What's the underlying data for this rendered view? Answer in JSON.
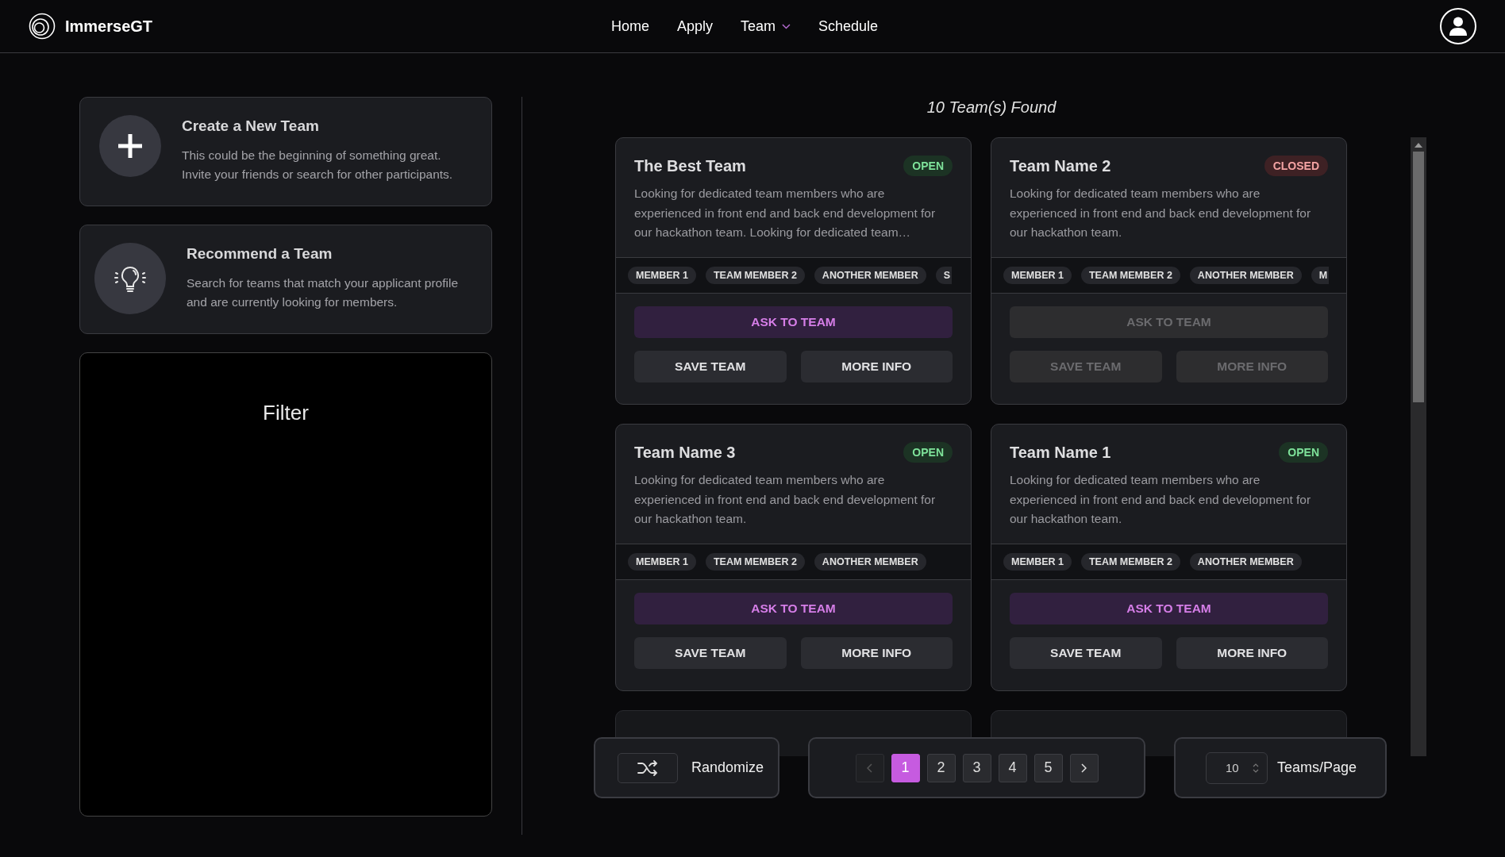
{
  "header": {
    "brand": "ImmerseGT",
    "nav": [
      {
        "label": "Home",
        "has_menu": false
      },
      {
        "label": "Apply",
        "has_menu": false
      },
      {
        "label": "Team",
        "has_menu": true
      },
      {
        "label": "Schedule",
        "has_menu": false
      }
    ]
  },
  "actions": [
    {
      "kind": "create",
      "title": "Create a New Team",
      "text": "This could be the beginning of something great. Invite your friends or search for other participants."
    },
    {
      "kind": "recommend",
      "title": "Recommend a Team",
      "text": "Search for teams that match your applicant profile and are currently looking for members."
    }
  ],
  "filter": {
    "title": "Filter"
  },
  "results": {
    "count_text": "10 Team(s) Found"
  },
  "teams": [
    {
      "name": "The Best Team",
      "badge": "OPEN",
      "open": true,
      "description": "Looking for dedicated team members who are experienced in front end and back end development for our hackathon team. Looking for dedicated team…",
      "members": [
        {
          "label": "MEMBER 1",
          "cut": false
        },
        {
          "label": "TEAM MEMBER 2",
          "cut": false
        },
        {
          "label": "ANOTHER MEMBER",
          "cut": false
        },
        {
          "label": "S",
          "cut": true
        }
      ],
      "buttons": {
        "ask": "ASK TO TEAM",
        "save": "SAVE TEAM",
        "info": "MORE INFO"
      }
    },
    {
      "name": "Team Name 2",
      "badge": "CLOSED",
      "open": false,
      "description": "Looking for dedicated team members who are experienced in front end and back end development for our hackathon team.",
      "members": [
        {
          "label": "MEMBER 1",
          "cut": false
        },
        {
          "label": "TEAM MEMBER 2",
          "cut": false
        },
        {
          "label": "ANOTHER MEMBER",
          "cut": false
        },
        {
          "label": "M",
          "cut": true
        }
      ],
      "buttons": {
        "ask": "ASK TO TEAM",
        "save": "SAVE TEAM",
        "info": "MORE INFO"
      }
    },
    {
      "name": "Team Name 3",
      "badge": "OPEN",
      "open": true,
      "description": "Looking for dedicated team members who are experienced in front end and back end development for our hackathon team.",
      "members": [
        {
          "label": "MEMBER 1",
          "cut": false
        },
        {
          "label": "TEAM MEMBER 2",
          "cut": false
        },
        {
          "label": "ANOTHER MEMBER",
          "cut": false
        }
      ],
      "buttons": {
        "ask": "ASK TO TEAM",
        "save": "SAVE TEAM",
        "info": "MORE INFO"
      }
    },
    {
      "name": "Team Name 1",
      "badge": "OPEN",
      "open": true,
      "description": "Looking for dedicated team members who are experienced in front end and back end development for our hackathon team.",
      "members": [
        {
          "label": "MEMBER 1",
          "cut": false
        },
        {
          "label": "TEAM MEMBER 2",
          "cut": false
        },
        {
          "label": "ANOTHER MEMBER",
          "cut": false
        }
      ],
      "buttons": {
        "ask": "ASK TO TEAM",
        "save": "SAVE TEAM",
        "info": "MORE INFO"
      }
    }
  ],
  "bottom_bar": {
    "randomize": "Randomize",
    "pages": [
      {
        "label": "1",
        "selected": true
      },
      {
        "label": "2",
        "selected": false
      },
      {
        "label": "3",
        "selected": false
      },
      {
        "label": "4",
        "selected": false
      },
      {
        "label": "5",
        "selected": false
      }
    ],
    "prev_disabled": true,
    "per_page_value": "10",
    "per_page_label": "Teams/Page"
  }
}
